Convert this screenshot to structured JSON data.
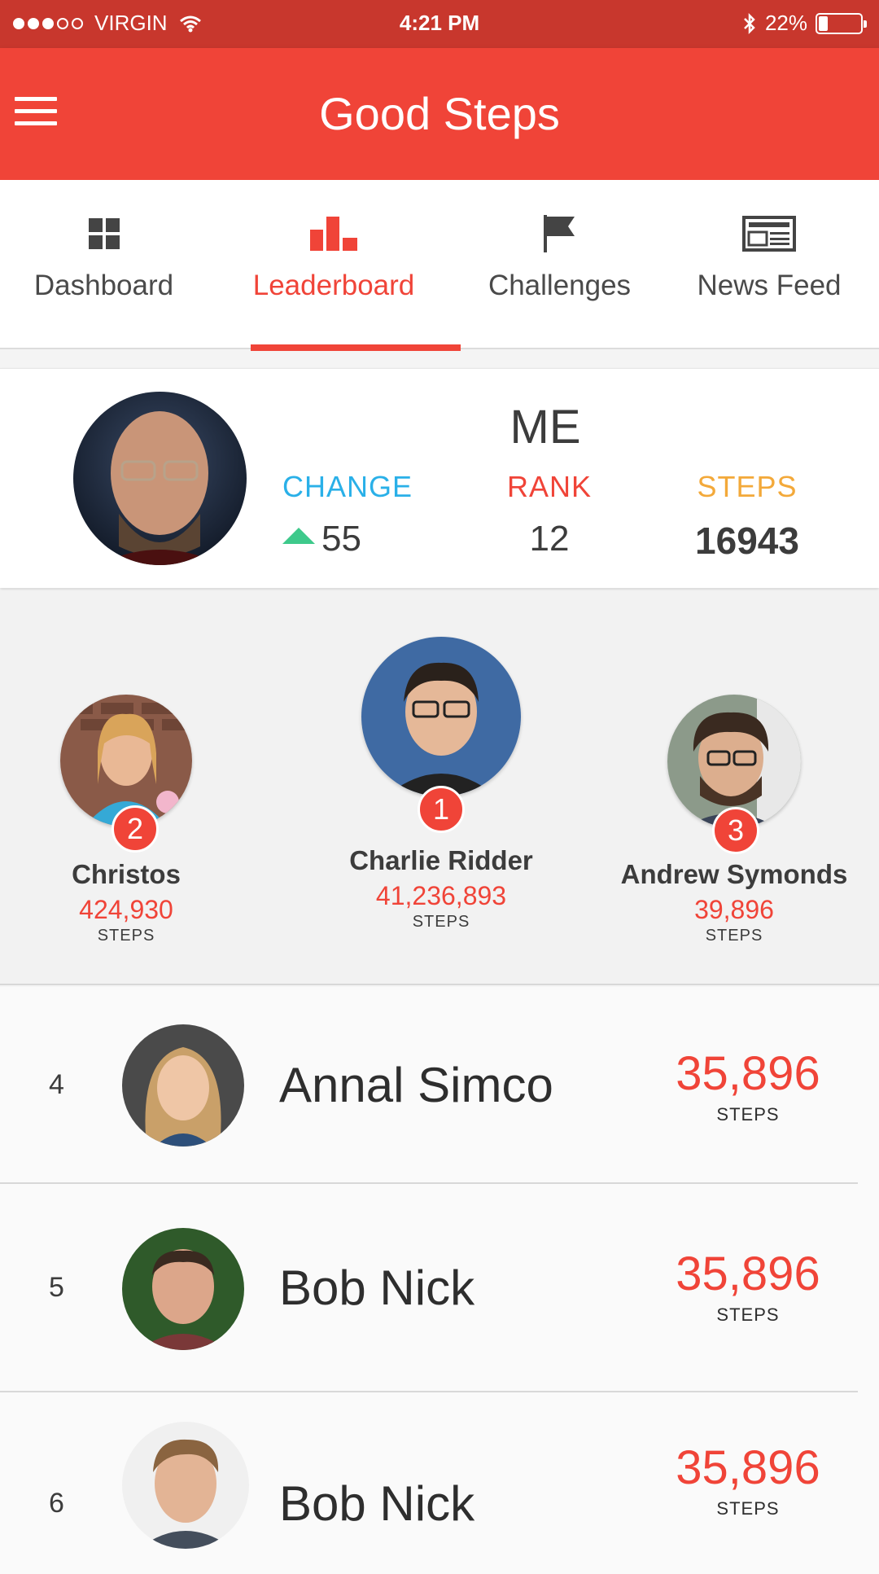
{
  "status_bar": {
    "carrier": "VIRGIN",
    "time": "4:21 PM",
    "battery": "22%",
    "battery_level": 0.22,
    "signal_dots_filled": 3,
    "signal_dots_total": 5
  },
  "app_bar": {
    "title": "Good Steps",
    "menu_icon": "hamburger-menu-icon",
    "color": "#f04438"
  },
  "tabs": [
    {
      "label": "Dashboard",
      "icon": "grid-icon",
      "active": false
    },
    {
      "label": "Leaderboard",
      "icon": "bar-chart-icon",
      "active": true
    },
    {
      "label": "Challenges",
      "icon": "flag-icon",
      "active": false
    },
    {
      "label": "News Feed",
      "icon": "newspaper-icon",
      "active": false
    }
  ],
  "me": {
    "title": "ME",
    "change_label": "CHANGE",
    "change_value": "55",
    "rank_label": "RANK",
    "rank_value": "12",
    "steps_label": "STEPS",
    "steps_value": "16943"
  },
  "podium": [
    {
      "rank": "2",
      "name": "Christos",
      "steps": "424,930",
      "steps_label": "STEPS"
    },
    {
      "rank": "1",
      "name": "Charlie Ridder",
      "steps": "41,236,893",
      "steps_label": "STEPS"
    },
    {
      "rank": "3",
      "name": "Andrew Symonds",
      "steps": "39,896",
      "steps_label": "STEPS"
    }
  ],
  "list": [
    {
      "rank": "4",
      "name": "Annal Simco",
      "steps": "35,896",
      "steps_label": "STEPS"
    },
    {
      "rank": "5",
      "name": "Bob Nick",
      "steps": "35,896",
      "steps_label": "STEPS"
    },
    {
      "rank": "6",
      "name": "Bob Nick",
      "steps": "35,896",
      "steps_label": "STEPS"
    }
  ],
  "colors": {
    "accent": "#f04438",
    "status_bar": "#c8372d",
    "change": "#2ab0e8",
    "steps_header": "#f3a93a",
    "up_arrow": "#3ec98b"
  }
}
